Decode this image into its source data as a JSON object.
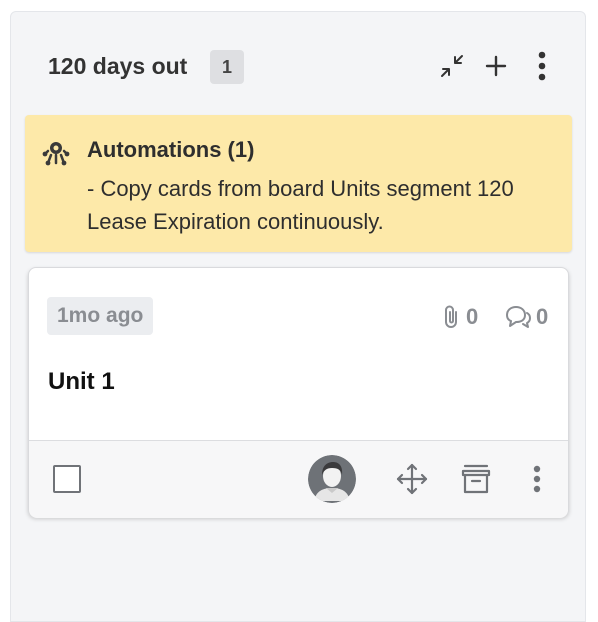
{
  "column": {
    "title": "120 days out",
    "count": "1"
  },
  "automation": {
    "title": "Automations (1)",
    "text": "- Copy cards from board Units segment 120 Lease Expiration continuously."
  },
  "card": {
    "time": "1mo ago",
    "attachments": "0",
    "comments": "0",
    "title": "Unit 1"
  },
  "icons": {
    "collapse": "collapse-arrows-icon",
    "add": "plus-icon",
    "more": "vertical-dots-icon",
    "automation": "automation-icon",
    "attachment": "paperclip-icon",
    "comment": "comment-bubbles-icon",
    "avatar": "user-avatar",
    "move": "move-arrows-icon",
    "archive": "archive-box-icon"
  },
  "colors": {
    "automation_bg": "#fde9a9",
    "column_bg": "#f4f5f7"
  }
}
